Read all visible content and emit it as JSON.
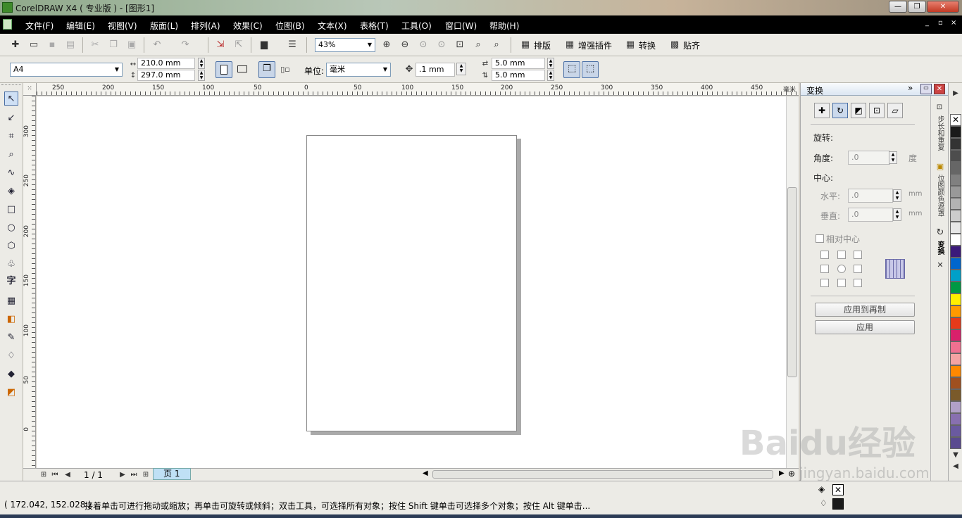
{
  "window": {
    "title": "CorelDRAW X4 ( 专业版 ) - [图形1]",
    "minimize": "—",
    "maximize": "❐",
    "close": "✕"
  },
  "menu": [
    "文件(F)",
    "编辑(E)",
    "视图(V)",
    "版面(L)",
    "排列(A)",
    "效果(C)",
    "位图(B)",
    "文本(X)",
    "表格(T)",
    "工具(O)",
    "窗口(W)",
    "帮助(H)"
  ],
  "mdi_controls": [
    "_",
    "▫",
    "×"
  ],
  "toolbar": {
    "zoom": "43%",
    "layout_label": "排版",
    "plugin_label": "增强插件",
    "convert_label": "转换",
    "snap_label": "贴齐"
  },
  "property_bar": {
    "paper": "A4",
    "width": "210.0 mm",
    "height": "297.0 mm",
    "unit_label": "单位:",
    "unit_value": "毫米",
    "nudge": ".1 mm",
    "dup_x": "5.0 mm",
    "dup_y": "5.0 mm"
  },
  "ruler_h": [
    "250",
    "200",
    "150",
    "100",
    "50",
    "0",
    "50",
    "100",
    "150",
    "200",
    "250",
    "300",
    "350",
    "400",
    "450"
  ],
  "ruler_v": [
    "300",
    "250",
    "200",
    "150",
    "100",
    "50",
    "0"
  ],
  "ruler_unit": "毫米",
  "page_nav": {
    "count": "1 / 1",
    "tab": "页 1"
  },
  "docker": {
    "title": "变换",
    "section": "旋转:",
    "angle_label": "角度:",
    "angle_value": ".0",
    "angle_unit": "度",
    "center_label": "中心:",
    "h_label": "水平:",
    "h_value": ".0",
    "h_unit": "mm",
    "v_label": "垂直:",
    "v_value": ".0",
    "v_unit": "mm",
    "relative_center": "相对中心",
    "apply_dup": "应用到再制",
    "apply": "应用"
  },
  "docker_tabs": [
    "步长和重复",
    "位图颜色遮罩",
    "变换"
  ],
  "palette": [
    "#1a1a1a",
    "#333333",
    "#4d4d4d",
    "#666666",
    "#808080",
    "#999999",
    "#b3b3b3",
    "#cccccc",
    "#e6e6e6",
    "#ffffff",
    "#3b1a7a",
    "#0066cc",
    "#00a0c8",
    "#009944",
    "#ffee00",
    "#ff9900",
    "#e63a1a",
    "#d9206b",
    "#f07090",
    "#f5a3a3",
    "#ff8800",
    "#a05020",
    "#7a5a2a",
    "#b0a0c8",
    "#8870b0",
    "#6a5aa0",
    "#5a4a90",
    "#3a2a70"
  ],
  "status": {
    "coords": "( 172.042, 152.028 )",
    "hint": "接着单击可进行拖动或缩放；再单击可旋转或倾斜；双击工具，可选择所有对象；按住 Shift 键单击可选择多个对象；按住 Alt 键单击..."
  },
  "watermark": {
    "brand": "Baidu经验",
    "url": "jingyan.baidu.com"
  }
}
